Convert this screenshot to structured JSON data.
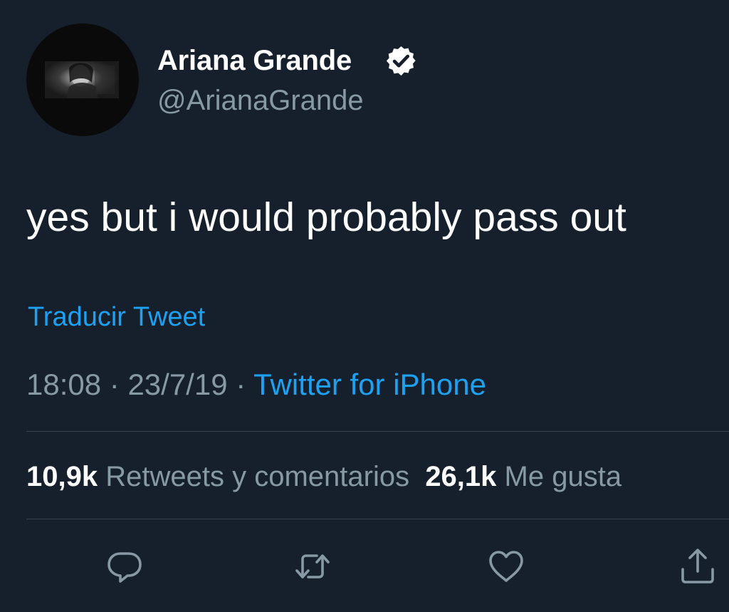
{
  "tweet": {
    "author": {
      "name": "Ariana Grande",
      "handle": "@ArianaGrande",
      "verified": true,
      "avatar_icon": "profile-photo"
    },
    "text": "yes but i would probably pass out",
    "translate_label": "Traducir Tweet",
    "meta": {
      "time": "18:08",
      "separator": " · ",
      "date": "23/7/19",
      "source": "Twitter for iPhone"
    },
    "stats": {
      "retweets_count": "10,9k",
      "retweets_label": "Retweets y comentarios",
      "likes_count": "26,1k",
      "likes_label": "Me gusta"
    },
    "actions": [
      {
        "name": "reply",
        "icon": "comment-bubble-icon"
      },
      {
        "name": "retweet",
        "icon": "retweet-icon"
      },
      {
        "name": "like",
        "icon": "heart-icon"
      },
      {
        "name": "share",
        "icon": "share-icon"
      }
    ]
  },
  "colors": {
    "background": "#16202c",
    "primary_text": "#ffffff",
    "secondary_text": "#8899a6",
    "link": "#1da1f2",
    "divider": "#38444d"
  }
}
